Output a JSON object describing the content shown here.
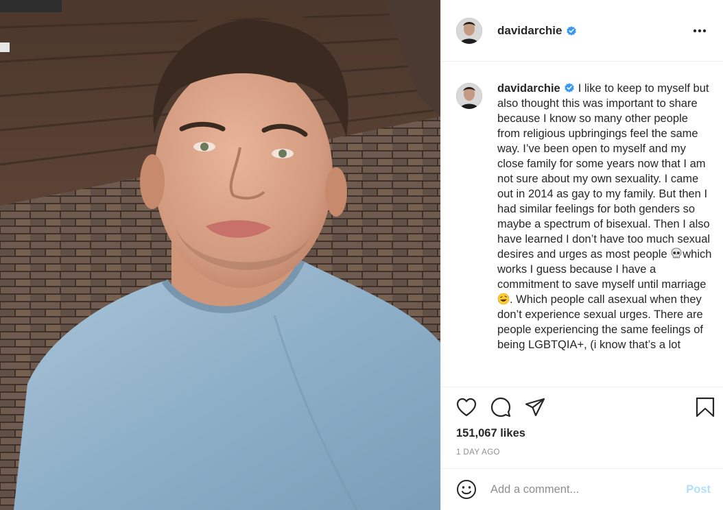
{
  "post": {
    "username": "davidarchie",
    "verified": true,
    "more_icon": "more-horizontal-icon",
    "photo_alt": "selfie photo"
  },
  "caption": {
    "username": "davidarchie",
    "parts": [
      "I like to keep to myself but also thought this was important to share because I know so many other people from religious upbringings feel the same way. I’ve been open to myself and my close family for some years now that I am not sure about my own sexuality. I came out in 2014 as gay to my family. But then I had similar feelings for both genders so maybe a spectrum of bisexual. Then I also have learned I don’t have too much sexual desires and urges as most people ",
      "which works I guess because I have a commitment to save myself until marriage ",
      ". Which people call asexual when they don’t experience sexual urges. There are people experiencing the same feelings of being LGBTQIA+, (i know that’s a lot"
    ],
    "emojis": [
      "skull-emoji",
      "rolling-on-floor-laughing-emoji"
    ]
  },
  "actions": {
    "icons": [
      "heart-icon",
      "comment-icon",
      "share-icon",
      "bookmark-icon"
    ],
    "likes": "151,067 likes",
    "time_ago": "1 DAY AGO"
  },
  "comment": {
    "placeholder": "Add a comment...",
    "post_label": "Post",
    "emoji_icon": "smiley-icon"
  },
  "colors": {
    "verified_blue": "#3897f0",
    "post_button_disabled": "#b2dffc",
    "muted_text": "#8e8e8e",
    "divider": "#efefef"
  }
}
